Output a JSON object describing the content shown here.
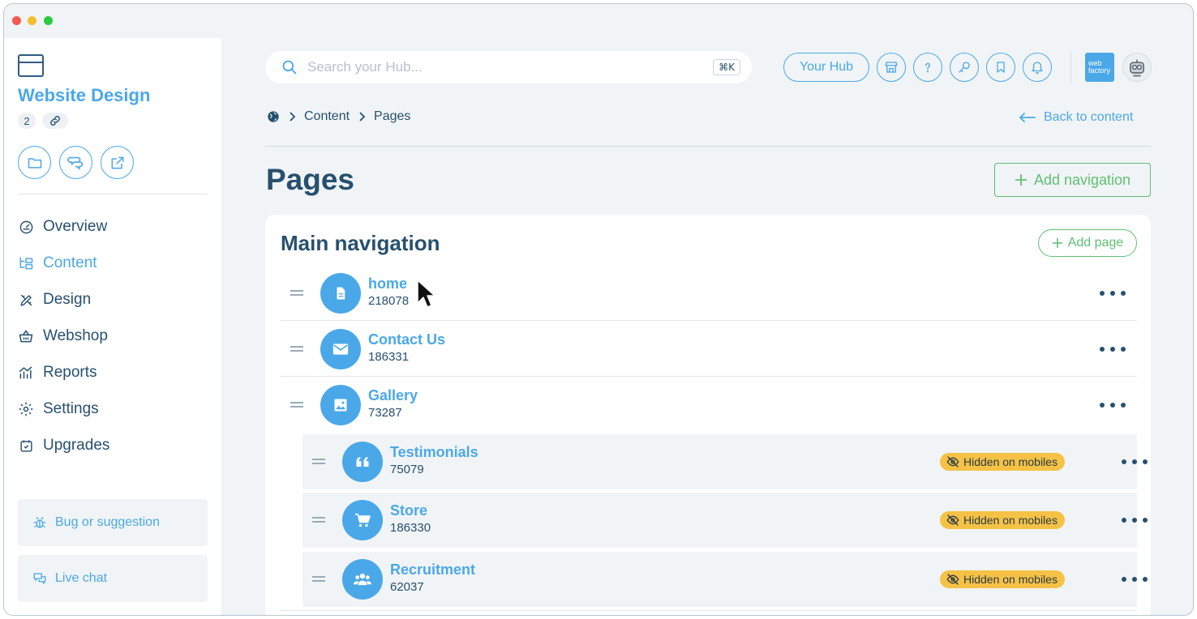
{
  "sidebar": {
    "app_title": "Website Design",
    "count": "2",
    "nav": [
      {
        "label": "Overview",
        "icon": "gauge-icon"
      },
      {
        "label": "Content",
        "icon": "sitemap-icon",
        "active": true
      },
      {
        "label": "Design",
        "icon": "design-tools-icon"
      },
      {
        "label": "Webshop",
        "icon": "basket-icon"
      },
      {
        "label": "Reports",
        "icon": "reports-chart-icon"
      },
      {
        "label": "Settings",
        "icon": "gear-icon"
      },
      {
        "label": "Upgrades",
        "icon": "calendar-check-icon"
      }
    ],
    "bug_label": "Bug or suggestion",
    "chat_label": "Live chat"
  },
  "header": {
    "search_placeholder": "Search your Hub...",
    "search_shortcut": "⌘K",
    "hub_label": "Your Hub",
    "logo_line1": "web",
    "logo_line2": "factory"
  },
  "breadcrumb": {
    "items": [
      "Content",
      "Pages"
    ]
  },
  "back_label": "Back to content",
  "page_title": "Pages",
  "add_navigation_label": "Add navigation",
  "navigation": {
    "title": "Main navigation",
    "add_page_label": "Add page",
    "pages": [
      {
        "name": "home",
        "id": "218078",
        "icon": "document-icon",
        "level": 0,
        "hidden_on_mobiles": false
      },
      {
        "name": "Contact Us",
        "id": "186331",
        "icon": "envelope-icon",
        "level": 0,
        "hidden_on_mobiles": false
      },
      {
        "name": "Gallery",
        "id": "73287",
        "icon": "image-icon",
        "level": 0,
        "hidden_on_mobiles": false
      },
      {
        "name": "Testimonials",
        "id": "75079",
        "icon": "quote-icon",
        "level": 1,
        "hidden_on_mobiles": true
      },
      {
        "name": "Store",
        "id": "186330",
        "icon": "cart-icon",
        "level": 1,
        "hidden_on_mobiles": true
      },
      {
        "name": "Recruitment",
        "id": "62037",
        "icon": "users-icon",
        "level": 1,
        "hidden_on_mobiles": true
      }
    ],
    "hidden_badge_label": "Hidden on mobiles"
  },
  "colors": {
    "accent": "#4aa8e8",
    "navy": "#27506f",
    "green": "#5fbf72",
    "badge": "#f5c246",
    "background": "#f1f4f6"
  }
}
